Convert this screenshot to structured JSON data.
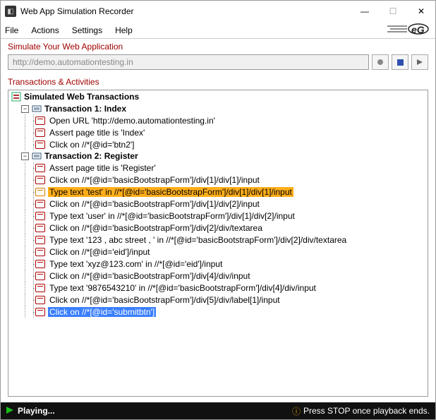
{
  "window": {
    "title": "Web App Simulation Recorder",
    "minimize": "—",
    "maximize": "☐",
    "close": "✕"
  },
  "menu": {
    "file": "File",
    "actions": "Actions",
    "settings": "Settings",
    "help": "Help"
  },
  "section": {
    "simulate": "Simulate Your Web Application",
    "transactions": "Transactions & Activities"
  },
  "url": {
    "value": "http://demo.automationtesting.in"
  },
  "tree": {
    "root": "Simulated Web Transactions",
    "tx1": {
      "label": "Transaction 1: Index",
      "a1": "Open URL 'http://demo.automationtesting.in'",
      "a2": "Assert page title is 'Index'",
      "a3": "Click on //*[@id='btn2']"
    },
    "tx2": {
      "label": "Transaction 2: Register",
      "a1": "Assert page title is 'Register'",
      "a2": "Click on //*[@id='basicBootstrapForm']/div[1]/div[1]/input",
      "a3": "Type text 'test' in //*[@id='basicBootstrapForm']/div[1]/div[1]/input",
      "a4": "Click on //*[@id='basicBootstrapForm']/div[1]/div[2]/input",
      "a5": "Type text 'user' in //*[@id='basicBootstrapForm']/div[1]/div[2]/input",
      "a6": "Click on //*[@id='basicBootstrapForm']/div[2]/div/textarea",
      "a7": "Type text '123 , abc street , ' in //*[@id='basicBootstrapForm']/div[2]/div/textarea",
      "a8": "Click on //*[@id='eid']/input",
      "a9": "Type text 'xyz@123.com' in //*[@id='eid']/input",
      "a10": "Click on //*[@id='basicBootstrapForm']/div[4]/div/input",
      "a11": "Type text '9876543210' in //*[@id='basicBootstrapForm']/div[4]/div/input",
      "a12": "Click on //*[@id='basicBootstrapForm']/div[5]/div/label[1]/input",
      "a13": "Click on //*[@id='submitbtn']"
    }
  },
  "status": {
    "playing": "Playing...",
    "hint": "Press STOP once playback ends."
  }
}
